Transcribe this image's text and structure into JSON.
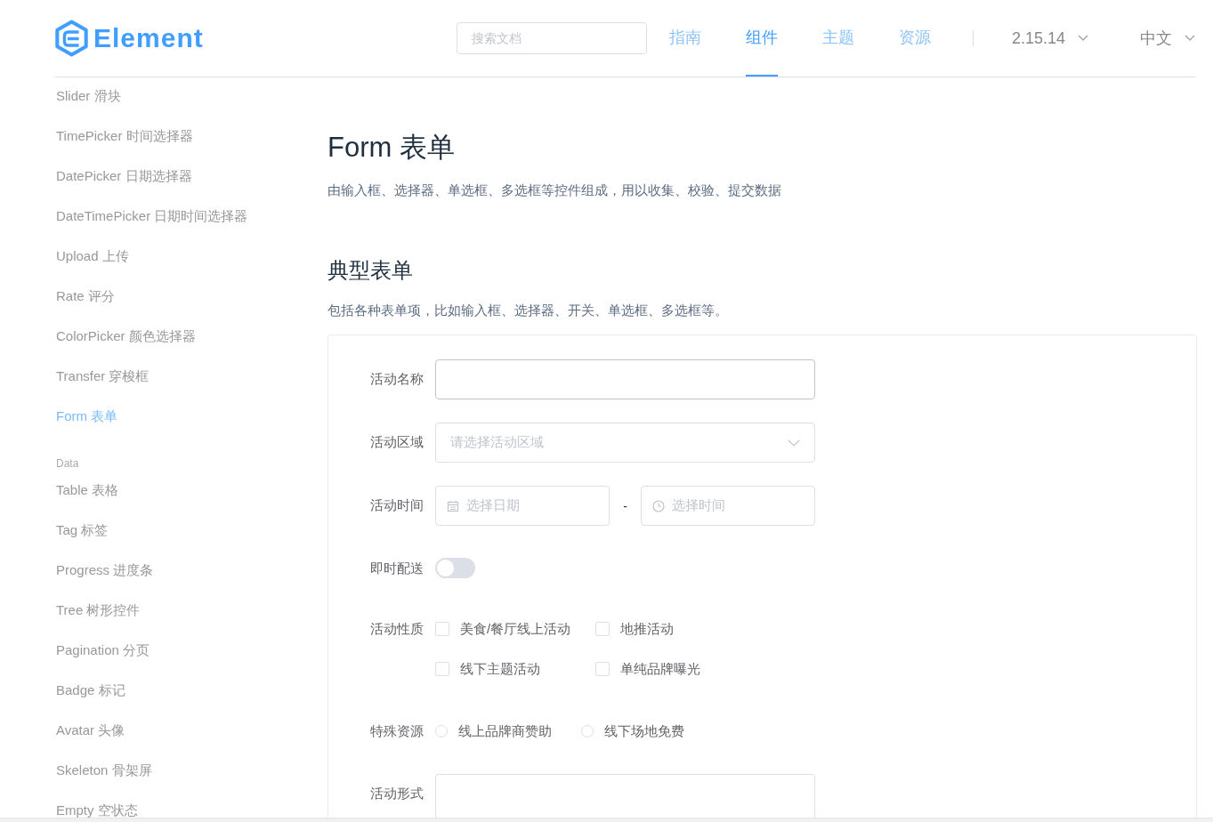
{
  "header": {
    "logo": "Element",
    "search": {
      "placeholder": "搜索文档"
    },
    "nav": [
      {
        "label": "指南",
        "selected": false
      },
      {
        "label": "组件",
        "selected": true
      },
      {
        "label": "主题",
        "selected": false
      },
      {
        "label": "资源",
        "selected": false
      }
    ],
    "version": "2.15.14",
    "language": "中文"
  },
  "sidebar": {
    "items": [
      {
        "kind": "link",
        "label": "Slider 滑块",
        "selected": false
      },
      {
        "kind": "link",
        "label": "TimePicker 时间选择器",
        "selected": false
      },
      {
        "kind": "link",
        "label": "DatePicker 日期选择器",
        "selected": false
      },
      {
        "kind": "link",
        "label": "DateTimePicker 日期时间选择器",
        "selected": false
      },
      {
        "kind": "link",
        "label": "Upload 上传",
        "selected": false
      },
      {
        "kind": "link",
        "label": "Rate 评分",
        "selected": false
      },
      {
        "kind": "link",
        "label": "ColorPicker 颜色选择器",
        "selected": false
      },
      {
        "kind": "link",
        "label": "Transfer 穿梭框",
        "selected": false
      },
      {
        "kind": "link",
        "label": "Form 表单",
        "selected": true
      },
      {
        "kind": "group",
        "label": "Data"
      },
      {
        "kind": "link",
        "label": "Table 表格",
        "selected": false
      },
      {
        "kind": "link",
        "label": "Tag 标签",
        "selected": false
      },
      {
        "kind": "link",
        "label": "Progress 进度条",
        "selected": false
      },
      {
        "kind": "link",
        "label": "Tree 树形控件",
        "selected": false
      },
      {
        "kind": "link",
        "label": "Pagination 分页",
        "selected": false
      },
      {
        "kind": "link",
        "label": "Badge 标记",
        "selected": false
      },
      {
        "kind": "link",
        "label": "Avatar 头像",
        "selected": false
      },
      {
        "kind": "link",
        "label": "Skeleton 骨架屏",
        "selected": false
      },
      {
        "kind": "link",
        "label": "Empty 空状态",
        "selected": false
      }
    ]
  },
  "page": {
    "title": "Form 表单",
    "description": "由输入框、选择器、单选框、多选框等控件组成，用以收集、校验、提交数据",
    "section_title": "典型表单",
    "section_description": "包括各种表单项，比如输入框、选择器、开关、单选框、多选框等。"
  },
  "form": {
    "fields": [
      {
        "kind": "input",
        "label": "活动名称"
      },
      {
        "kind": "select",
        "label": "活动区域",
        "placeholder": "请选择活动区域"
      },
      {
        "kind": "datetime",
        "label": "活动时间",
        "date_placeholder": "选择日期",
        "separator": "-",
        "time_placeholder": "选择时间"
      },
      {
        "kind": "switch",
        "label": "即时配送",
        "on": false
      },
      {
        "kind": "checkboxes",
        "label": "活动性质",
        "options": [
          {
            "label": "美食/餐厅线上活动",
            "checked": false
          },
          {
            "label": "地推活动",
            "checked": false
          },
          {
            "label": "线下主题活动",
            "checked": false
          },
          {
            "label": "单纯品牌曝光",
            "checked": false
          }
        ]
      },
      {
        "kind": "radios",
        "label": "特殊资源",
        "options": [
          {
            "label": "线上品牌商赞助",
            "selected": false
          },
          {
            "label": "线下场地免费",
            "selected": false
          }
        ]
      },
      {
        "kind": "textarea",
        "label": "活动形式"
      }
    ]
  }
}
